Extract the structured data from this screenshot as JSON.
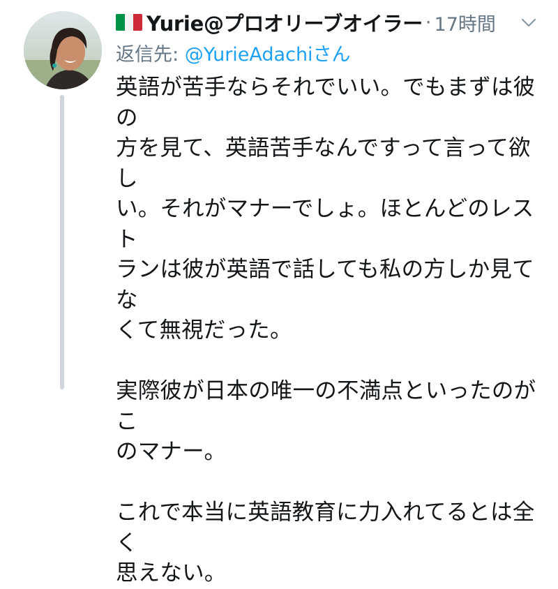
{
  "tweet": {
    "display_name": "Yurie@プロオリーブオイラー",
    "separator": "·",
    "time": "17時間",
    "reply_prefix": "返信先:",
    "reply_mention": "@YurieAdachi",
    "reply_suffix": "さん",
    "flag_icon": "italy-flag-icon",
    "menu_icon": "chevron-down-icon",
    "paragraphs": [
      "英語が苦手ならそれでいい。でもまずは彼の\n方を見て、英語苦手なんですって言って欲し\nい。それがマナーでしょ。ほとんどのレスト\nランは彼が英語で話しても私の方しか見てな\nくて無視だった。",
      "実際彼が日本の唯一の不満点といったのがこ\nのマナー。",
      "これで本当に英語教育に力入れてるとは全く\n思えない。"
    ]
  },
  "colors": {
    "text": "#14171a",
    "muted": "#657786",
    "link": "#1da1f2",
    "thread_line": "#d0d6db"
  }
}
